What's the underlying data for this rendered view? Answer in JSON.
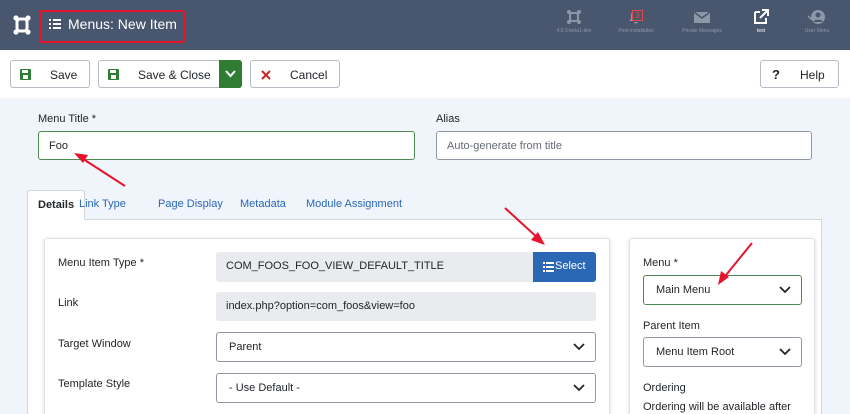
{
  "header": {
    "title": "Menus: New Item",
    "items": [
      {
        "label": "4.0.0-beta1-dev",
        "icon": "joomla-icon"
      },
      {
        "label": "Post-installation",
        "icon": "bell-icon",
        "badge": "3"
      },
      {
        "label": "Private Messages",
        "icon": "envelope-icon"
      },
      {
        "label": "test",
        "icon": "external-link-icon"
      },
      {
        "label": "User Menu",
        "icon": "user-icon"
      }
    ]
  },
  "toolbar": {
    "save_label": "Save",
    "save_close_label": "Save & Close",
    "cancel_label": "Cancel",
    "help_label": "Help"
  },
  "form": {
    "menu_title_label": "Menu Title *",
    "menu_title_value": "Foo",
    "alias_label": "Alias",
    "alias_placeholder": "Auto-generate from title"
  },
  "tabs": [
    "Details",
    "Link Type",
    "Page Display",
    "Metadata",
    "Module Assignment"
  ],
  "details": {
    "menu_item_type_label": "Menu Item Type *",
    "menu_item_type_value": "COM_FOOS_FOO_VIEW_DEFAULT_TITLE",
    "select_label": "Select",
    "link_label": "Link",
    "link_value": "index.php?option=com_foos&view=foo",
    "target_window_label": "Target Window",
    "target_window_value": "Parent",
    "template_style_label": "Template Style",
    "template_style_value": "- Use Default -"
  },
  "sidebar": {
    "menu_label": "Menu *",
    "menu_value": "Main Menu",
    "parent_label": "Parent Item",
    "parent_value": "Menu Item Root",
    "ordering_label": "Ordering",
    "ordering_text": "Ordering will be available after"
  },
  "colors": {
    "header_bg": "#48566e",
    "highlight_red": "#e8132b",
    "save_green": "#2f7d32",
    "cancel_red": "#c52827",
    "link_blue": "#2a69b8",
    "select_blue": "#2a68b6"
  }
}
